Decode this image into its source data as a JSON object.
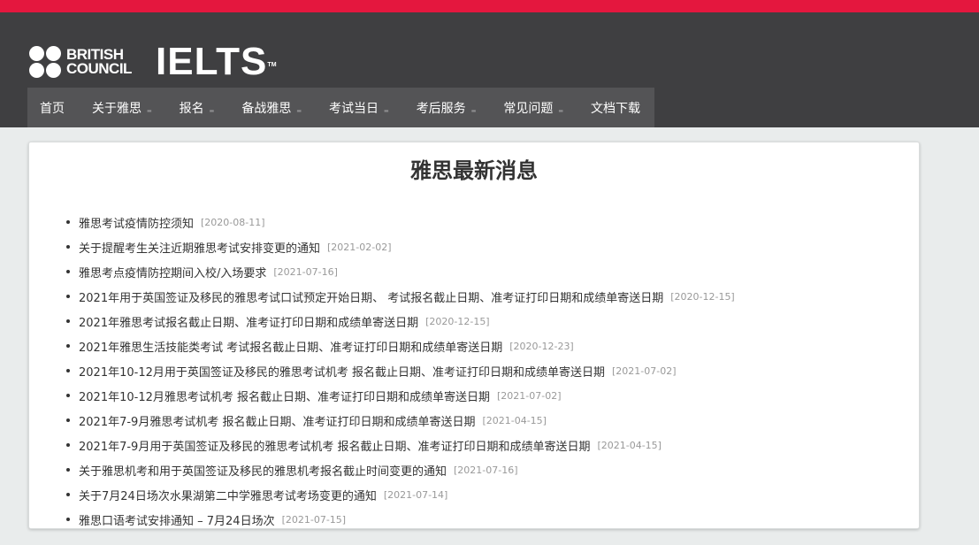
{
  "brand": {
    "bc_line1": "BRITISH",
    "bc_line2": "COUNCIL",
    "ielts": "IELTS",
    "tm": "TM"
  },
  "nav": {
    "items": [
      {
        "label": "首页",
        "dropdown": false
      },
      {
        "label": "关于雅思",
        "dropdown": true
      },
      {
        "label": "报名",
        "dropdown": true
      },
      {
        "label": "备战雅思",
        "dropdown": true
      },
      {
        "label": "考试当日",
        "dropdown": true
      },
      {
        "label": "考后服务",
        "dropdown": true
      },
      {
        "label": "常见问题",
        "dropdown": true
      },
      {
        "label": "文档下载",
        "dropdown": false
      }
    ]
  },
  "main": {
    "title": "雅思最新消息",
    "news": [
      {
        "title": "雅思考试疫情防控须知",
        "date": "[2020-08-11]"
      },
      {
        "title": "关于提醒考生关注近期雅思考试安排变更的通知",
        "date": "[2021-02-02]"
      },
      {
        "title": "雅思考点疫情防控期间入校/入场要求",
        "date": "[2021-07-16]"
      },
      {
        "title": "2021年用于英国签证及移民的雅思考试口试预定开始日期、 考试报名截止日期、准考证打印日期和成绩单寄送日期",
        "date": "[2020-12-15]"
      },
      {
        "title": "2021年雅思考试报名截止日期、准考证打印日期和成绩单寄送日期",
        "date": "[2020-12-15]"
      },
      {
        "title": "2021年雅思生活技能类考试 考试报名截止日期、准考证打印日期和成绩单寄送日期",
        "date": "[2020-12-23]"
      },
      {
        "title": "2021年10-12月用于英国签证及移民的雅思考试机考 报名截止日期、准考证打印日期和成绩单寄送日期",
        "date": "[2021-07-02]"
      },
      {
        "title": "2021年10-12月雅思考试机考 报名截止日期、准考证打印日期和成绩单寄送日期",
        "date": "[2021-07-02]"
      },
      {
        "title": "2021年7-9月雅思考试机考 报名截止日期、准考证打印日期和成绩单寄送日期",
        "date": "[2021-04-15]"
      },
      {
        "title": "2021年7-9月用于英国签证及移民的雅思考试机考 报名截止日期、准考证打印日期和成绩单寄送日期",
        "date": "[2021-04-15]"
      },
      {
        "title": "关于雅思机考和用于英国签证及移民的雅思机考报名截止时间变更的通知",
        "date": "[2021-07-16]"
      },
      {
        "title": "关于7月24日场次水果湖第二中学雅思考试考场变更的通知",
        "date": "[2021-07-14]"
      },
      {
        "title": "雅思口语考试安排通知 – 7月24日场次",
        "date": "[2021-07-15]"
      }
    ]
  },
  "colors": {
    "accent_bar": "#e4173e",
    "header_bg": "#3f3f41",
    "nav_bg": "#545456"
  }
}
